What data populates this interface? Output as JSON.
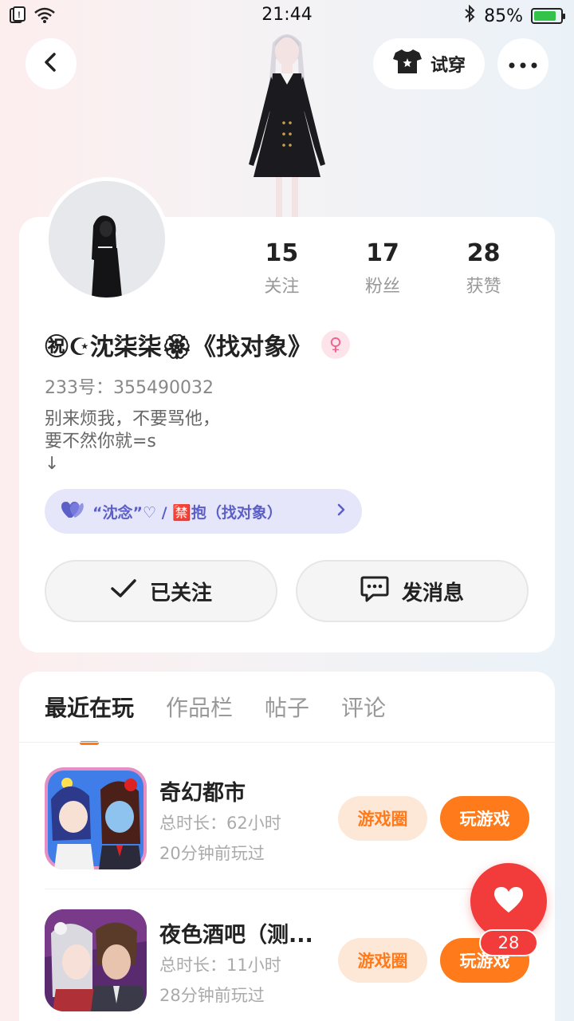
{
  "status": {
    "time": "21:44",
    "battery": "85%",
    "battery_level": 0.85
  },
  "header": {
    "tryon_label": "试穿"
  },
  "profile": {
    "stats": [
      {
        "num": "15",
        "label": "关注"
      },
      {
        "num": "17",
        "label": "粉丝"
      },
      {
        "num": "28",
        "label": "获赞"
      }
    ],
    "name": "㊗☪沈柒柒🏵《找对象》",
    "gender_symbol": "♀",
    "uid": "233号：355490032",
    "bio": "别来烦我，不要骂他，\n要不然你就=s\n↓",
    "tag": "“沈念”♡ / 🈲抱（找对象）",
    "follow_label": "已关注",
    "message_label": "发消息"
  },
  "tabs": [
    "最近在玩",
    "作品栏",
    "帖子",
    "评论"
  ],
  "games": [
    {
      "title": "奇幻都市",
      "duration": "总时长：62小时",
      "last_played": "20分钟前玩过",
      "circle_label": "游戏圈",
      "play_label": "玩游戏"
    },
    {
      "title": "夜色酒吧（测...",
      "duration": "总时长：11小时",
      "last_played": "28分钟前玩过",
      "circle_label": "游戏圈",
      "play_label": "玩游戏"
    }
  ],
  "like_count": "28",
  "colors": {
    "accent": "#ff7a1a",
    "like": "#f23b3b",
    "tag_bg": "#e6e6fb",
    "tag_text": "#5b5fc7"
  },
  "icons": [
    "notification-icon",
    "wifi-icon",
    "bluetooth-icon",
    "battery-icon",
    "back-icon",
    "shirt-icon",
    "more-icon",
    "check-icon",
    "message-icon",
    "heart-icon",
    "gender-female-icon",
    "chevron-right-icon"
  ]
}
